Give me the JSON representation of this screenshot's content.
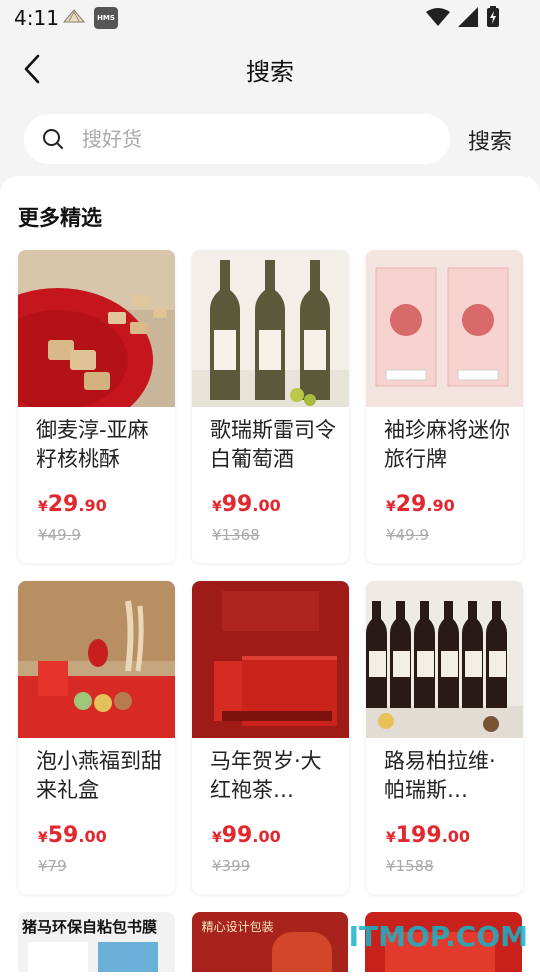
{
  "status_bar": {
    "time": "4:11",
    "hms_label": "HMS"
  },
  "nav": {
    "title": "搜索"
  },
  "search": {
    "placeholder": "搜好货",
    "button_label": "搜索"
  },
  "section": {
    "title": "更多精选"
  },
  "products": [
    {
      "name": "御麦淳-亚麻籽核桃酥",
      "currency": "¥",
      "price_int": "29",
      "price_dec": ".90",
      "orig": "¥49.9"
    },
    {
      "name": "歌瑞斯雷司令白葡萄酒",
      "currency": "¥",
      "price_int": "99",
      "price_dec": ".00",
      "orig": "¥1368"
    },
    {
      "name": "袖珍麻将迷你旅行牌",
      "currency": "¥",
      "price_int": "29",
      "price_dec": ".90",
      "orig": "¥49.9"
    },
    {
      "name": "泡小燕福到甜来礼盒",
      "currency": "¥",
      "price_int": "59",
      "price_dec": ".00",
      "orig": "¥79"
    },
    {
      "name": "马年贺岁·大红袍茶…",
      "currency": "¥",
      "price_int": "99",
      "price_dec": ".00",
      "orig": "¥399"
    },
    {
      "name": "路易柏拉维·帕瑞斯…",
      "currency": "¥",
      "price_int": "199",
      "price_dec": ".00",
      "orig": "¥1588"
    }
  ],
  "partial_cards": [
    {
      "banner": "猪马环保自粘包书膜"
    },
    {
      "banner": "精心设计包装"
    },
    {
      "banner": ""
    }
  ],
  "watermark": "ITMOP.COM",
  "colors": {
    "price": "#e0282e",
    "background": "#f4f4f4",
    "panel": "#ffffff"
  }
}
